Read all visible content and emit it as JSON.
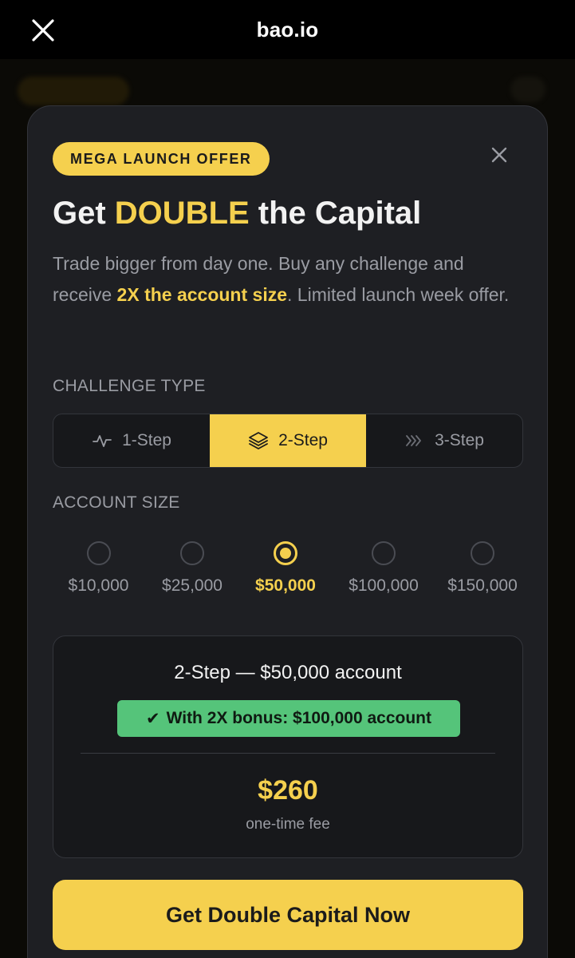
{
  "browser": {
    "title": "bao.io"
  },
  "modal": {
    "badge": "MEGA LAUNCH OFFER",
    "headline": {
      "prefix": "Get ",
      "accent": "DOUBLE",
      "suffix": " the Capital"
    },
    "subtext": {
      "part1": "Trade bigger from day one. Buy any challenge and receive ",
      "highlight": "2X the account size",
      "part2": ". Limited launch week offer."
    },
    "challenge_type": {
      "label": "CHALLENGE TYPE",
      "options": [
        {
          "label": "1-Step",
          "icon": "pulse-icon",
          "selected": false
        },
        {
          "label": "2-Step",
          "icon": "layers-icon",
          "selected": true
        },
        {
          "label": "3-Step",
          "icon": "triple-chevron-icon",
          "selected": false
        }
      ]
    },
    "account_size": {
      "label": "ACCOUNT SIZE",
      "options": [
        {
          "label": "$10,000",
          "selected": false
        },
        {
          "label": "$25,000",
          "selected": false
        },
        {
          "label": "$50,000",
          "selected": true
        },
        {
          "label": "$100,000",
          "selected": false
        },
        {
          "label": "$150,000",
          "selected": false
        }
      ]
    },
    "summary": {
      "title": "2-Step — $50,000 account",
      "bonus_check": "✔",
      "bonus": "With 2X bonus: $100,000 account",
      "price": "$260",
      "fee_label": "one-time fee"
    },
    "cta_label": "Get Double Capital Now"
  },
  "colors": {
    "accent": "#f5d04e",
    "bonus_green": "#55c47a",
    "card_bg": "#1e1f23",
    "muted_text": "#9a9ca3"
  }
}
